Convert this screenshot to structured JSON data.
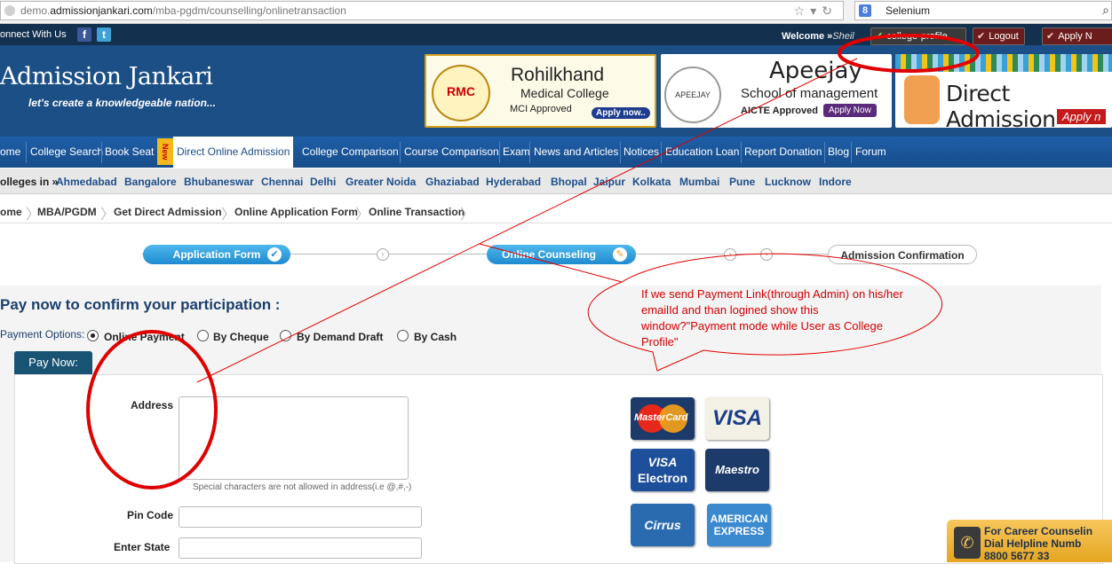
{
  "browser": {
    "url_prefix": "demo.",
    "url_domain": "admissionjankari.com",
    "url_path": "/mba-pgdm/counselling/onlinetransaction",
    "search_engine": "Selenium"
  },
  "header": {
    "connect_label": "onnect With Us",
    "welcome_label": "Welcome »",
    "welcome_name": "Sheil",
    "profile_button": "college-profile",
    "logout_button": "Logout",
    "apply_button": "Apply N",
    "logo": "Admission Jankari",
    "tagline": "let's create a knowledgeable nation..."
  },
  "banners": {
    "b1": {
      "emblem": "RMC",
      "title": "Rohilkhand",
      "subtitle": "Medical College",
      "note": "MCI Approved",
      "cta": "Apply now.."
    },
    "b2": {
      "emblem": "APEEJAY",
      "title": "Apeejay",
      "subtitle": "School of management",
      "note": "AICTE Approved",
      "cta": "Apply Now"
    },
    "b3": {
      "title": "Direct Admission",
      "cta": "Apply n"
    }
  },
  "nav": {
    "items": [
      "ome",
      "College Search",
      "Book Seat",
      "Direct Online Admission",
      "College Comparison",
      "Course Comparison",
      "Exam",
      "News and Articles",
      "Notices",
      "Education Loan",
      "Report Donation",
      "Blog",
      "Forum"
    ],
    "badge": "New"
  },
  "cities": {
    "label": "olleges in »",
    "items": [
      "Ahmedabad",
      "Bangalore",
      "Bhubaneswar",
      "Chennai",
      "Delhi",
      "Greater Noida",
      "Ghaziabad",
      "Hyderabad",
      "Bhopal",
      "Jaipur",
      "Kolkata",
      "Mumbai",
      "Pune",
      "Lucknow",
      "Indore"
    ]
  },
  "breadcrumb": [
    "ome",
    "MBA/PGDM",
    "Get Direct Admission",
    "Online Application Form",
    "Online Transaction"
  ],
  "steps": [
    "Application Form",
    "Online Counseling",
    "Admission Confirmation"
  ],
  "payment": {
    "title": "Pay now to confirm your participation :",
    "options_label": "Payment Options:",
    "options": [
      "Online Payment",
      "By Cheque",
      "By Demand Draft",
      "By Cash"
    ],
    "selected": "Online Payment",
    "pay_now_tab": "Pay Now:",
    "address_label": "Address",
    "address_hint": "Special characters are not allowed in address(i.e @,#,-)",
    "pin_label": "Pin Code",
    "state_label": "Enter State"
  },
  "cards": {
    "mastercard": "MasterCard",
    "visa": "VISA",
    "visa_electron_1": "VISA",
    "visa_electron_2": "Electron",
    "maestro": "Maestro",
    "cirrus": "Cirrus",
    "amex_1": "AMERICAN",
    "amex_2": "EXPRESS"
  },
  "helpline": {
    "line1": "For Career Counselin",
    "line2": "Dial Helpline Numb",
    "line3": "8800 5677 33"
  },
  "annotation": {
    "text": "If we send Payment Link(through Admin) on his/her emailId and than logined show this window?\"Payment mode while User as College Profile\""
  },
  "colors": {
    "header_bg": "#1c4f86",
    "nav_bg": "#1e5ea8",
    "step_active": "#1f8bd0",
    "annotation_red": "#d40000",
    "paynow_tab": "#195374"
  }
}
